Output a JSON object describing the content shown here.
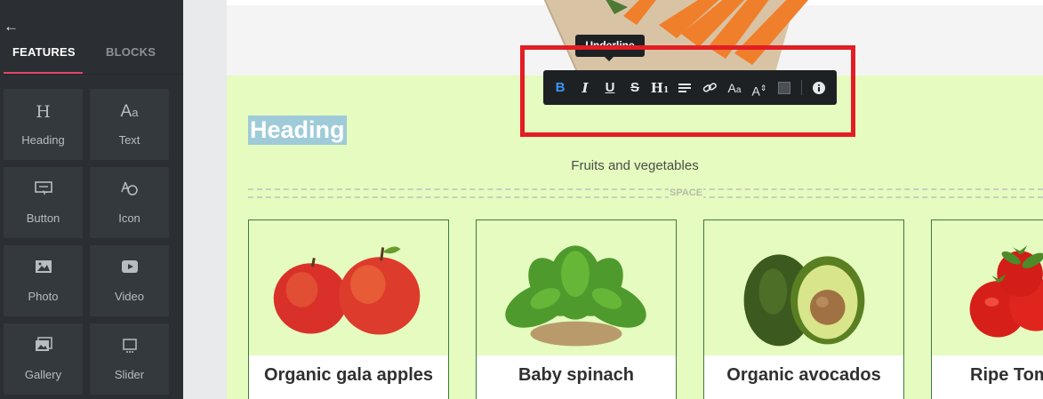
{
  "sidebar": {
    "tabs": {
      "features": "FEATURES",
      "blocks": "BLOCKS"
    },
    "tiles": [
      {
        "label": "Heading",
        "icon": "heading-icon"
      },
      {
        "label": "Text",
        "icon": "text-icon"
      },
      {
        "label": "Button",
        "icon": "button-icon"
      },
      {
        "label": "Icon",
        "icon": "icon-icon"
      },
      {
        "label": "Photo",
        "icon": "photo-icon"
      },
      {
        "label": "Video",
        "icon": "video-icon"
      },
      {
        "label": "Gallery",
        "icon": "gallery-icon"
      },
      {
        "label": "Slider",
        "icon": "slider-icon"
      }
    ]
  },
  "toolbar": {
    "tooltip": "Underline",
    "active_color": "#3b95f5"
  },
  "section": {
    "heading": "Heading",
    "subtitle": "Fruits and vegetables",
    "spacer_label": "SPACE",
    "background": "#e5fbbf"
  },
  "products": [
    {
      "name": "Organic gala apples"
    },
    {
      "name": "Baby spinach"
    },
    {
      "name": "Organic avocados"
    },
    {
      "name": "Ripe Tom"
    }
  ],
  "colors": {
    "highlight": "#e21e24",
    "tab_underline": "#e0476b",
    "card_border": "#3e7a3f"
  }
}
